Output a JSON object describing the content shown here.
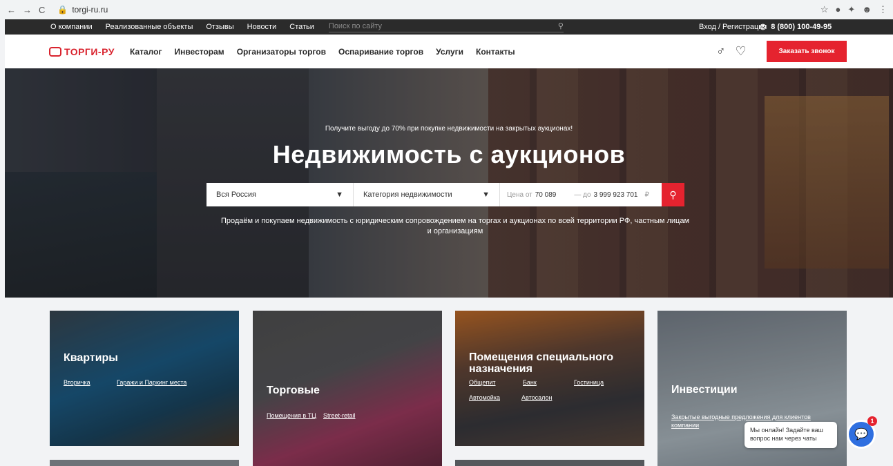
{
  "browser": {
    "url": "torgi-ru.ru"
  },
  "topbar": {
    "links": [
      "О компании",
      "Реализованные объекты",
      "Отзывы",
      "Новости",
      "Статьи"
    ],
    "search_placeholder": "Поиск по сайту",
    "login": "Вход / Регистрация",
    "phone": "8 (800) 100-49-95"
  },
  "header": {
    "logo": "ТОРГИ-РУ",
    "menu": [
      "Каталог",
      "Инвесторам",
      "Организаторы торгов",
      "Оспаривание торгов",
      "Услуги",
      "Контакты"
    ],
    "call_button": "Заказать звонок"
  },
  "hero": {
    "tagline": "Получите выгоду до 70% при покупке недвижимости на закрытых аукционах!",
    "title": "Недвижимость с аукционов",
    "region": "Вся Россия",
    "category": "Категория недвижимости",
    "price_from_label": "Цена от",
    "price_from": "70 089",
    "price_to_label": "— до",
    "price_to": "3 999 923 701",
    "currency": "₽",
    "subtitle": "Продаём и покупаем недвижимость с юридическим сопровождением на торгах и аукционах по всей территории РФ, частным лицам и организациям"
  },
  "cards": [
    {
      "title": "Квартиры",
      "links": [
        "Вторичка",
        "Гаражи и Паркинг места"
      ]
    },
    {
      "title": "Торговые",
      "links": [
        "Помещения в ТЦ",
        "Street-retail"
      ]
    },
    {
      "title": "Помещения специального назначения",
      "links": [
        "Общепит",
        "Банк",
        "Гостиница",
        "Автомойка",
        "Автосалон"
      ]
    },
    {
      "title": "Инвестиции",
      "links": [
        "Закрытые выгодные предложения для клиентов компании"
      ]
    }
  ],
  "chat": {
    "text": "Мы онлайн! Задайте ваш вопрос нам через чаты",
    "badge": "1"
  }
}
